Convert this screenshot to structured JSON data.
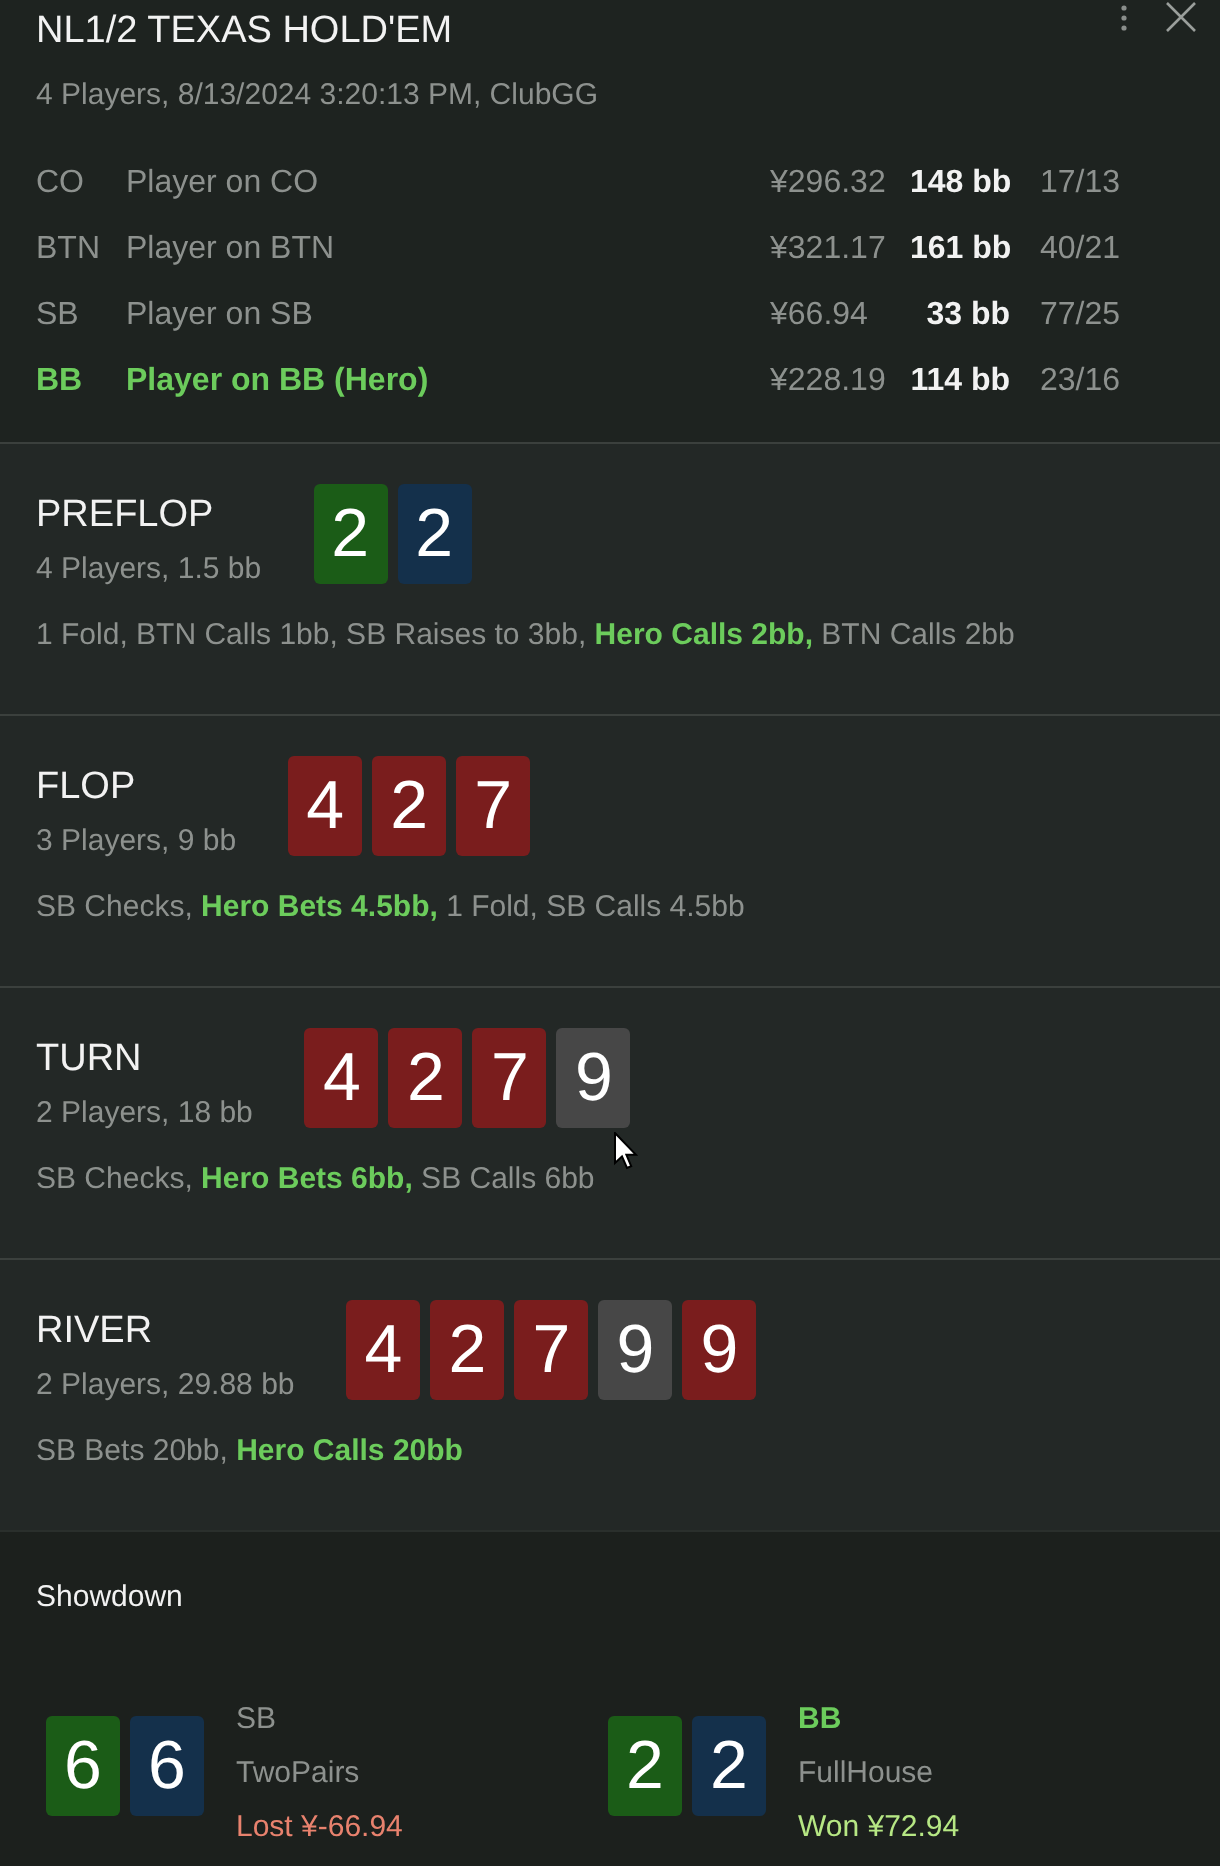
{
  "header": {
    "title": "NL1/2 TEXAS HOLD'EM",
    "subtitle": "4 Players, 8/13/2024 3:20:13 PM, ClubGG"
  },
  "players": [
    {
      "position": "CO",
      "name": "Player on CO",
      "stack": "¥296.32",
      "stack_bb": "148 bb",
      "stats": "17/13",
      "hero": false
    },
    {
      "position": "BTN",
      "name": "Player on BTN",
      "stack": "¥321.17",
      "stack_bb": "161 bb",
      "stats": "40/21",
      "hero": false
    },
    {
      "position": "SB",
      "name": "Player on SB",
      "stack": "¥66.94",
      "stack_bb": "33 bb",
      "stats": "77/25",
      "hero": false
    },
    {
      "position": "BB",
      "name": "Player on BB (Hero)",
      "stack": "¥228.19",
      "stack_bb": "114 bb",
      "stats": "23/16",
      "hero": true
    }
  ],
  "streets": [
    {
      "name": "PREFLOP",
      "info": "4 Players, 1.5 bb",
      "cards": [
        {
          "rank": "2",
          "color": "#1b5c17"
        },
        {
          "rank": "2",
          "color": "#14304b"
        }
      ],
      "actions": "1 Fold, BTN Calls 1bb, SB Raises to 3bb, **Hero Calls 2bb,** BTN Calls 2bb"
    },
    {
      "name": "FLOP",
      "info": "3 Players, 9 bb",
      "cards": [
        {
          "rank": "4",
          "color": "#7a1d1d"
        },
        {
          "rank": "2",
          "color": "#7a1d1d"
        },
        {
          "rank": "7",
          "color": "#7a1d1d"
        }
      ],
      "actions": "SB Checks, **Hero Bets 4.5bb,** 1 Fold, SB Calls 4.5bb"
    },
    {
      "name": "TURN",
      "info": "2 Players, 18 bb",
      "cards": [
        {
          "rank": "4",
          "color": "#7a1d1d"
        },
        {
          "rank": "2",
          "color": "#7a1d1d"
        },
        {
          "rank": "7",
          "color": "#7a1d1d"
        },
        {
          "rank": "9",
          "color": "#474747"
        }
      ],
      "actions": "SB Checks, **Hero Bets 6bb,** SB Calls 6bb"
    },
    {
      "name": "RIVER",
      "info": "2 Players, 29.88 bb",
      "cards": [
        {
          "rank": "4",
          "color": "#7a1d1d"
        },
        {
          "rank": "2",
          "color": "#7a1d1d"
        },
        {
          "rank": "7",
          "color": "#7a1d1d"
        },
        {
          "rank": "9",
          "color": "#474747"
        },
        {
          "rank": "9",
          "color": "#7a1d1d"
        }
      ],
      "actions": "SB Bets 20bb, **Hero Calls 20bb**"
    }
  ],
  "showdown": {
    "title": "Showdown",
    "hands": [
      {
        "position": "SB",
        "hero": false,
        "cards": [
          {
            "rank": "6",
            "color": "#1b5c17"
          },
          {
            "rank": "6",
            "color": "#14304b"
          }
        ],
        "hand": "TwoPairs",
        "result": "Lost ¥-66.94",
        "won": false
      },
      {
        "position": "BB",
        "hero": true,
        "cards": [
          {
            "rank": "2",
            "color": "#1b5c17"
          },
          {
            "rank": "2",
            "color": "#14304b"
          }
        ],
        "hand": "FullHouse",
        "result": "Won ¥72.94",
        "won": true
      }
    ]
  }
}
